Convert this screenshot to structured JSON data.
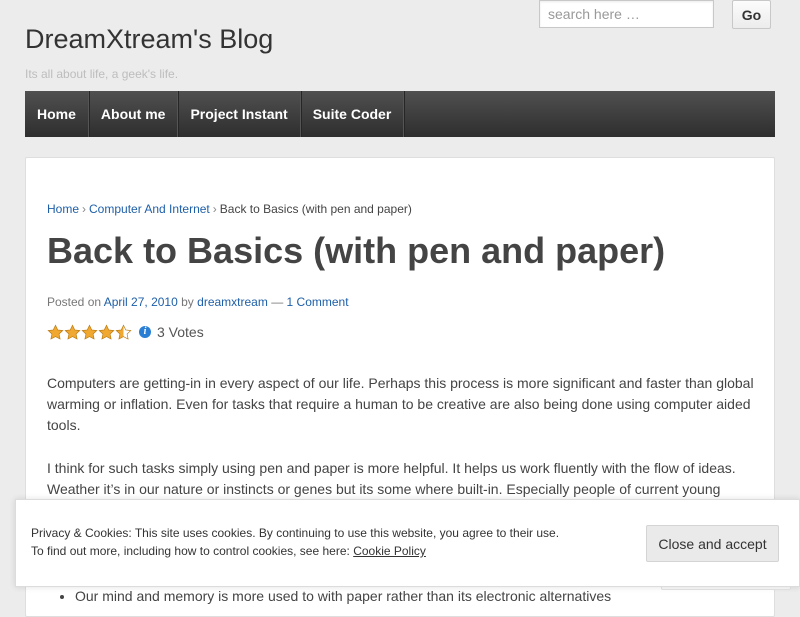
{
  "site": {
    "title": "DreamXtream's Blog",
    "tagline": "Its all about life, a geek's life."
  },
  "search": {
    "placeholder": "search here …",
    "button_label": "Go"
  },
  "nav": {
    "items": [
      {
        "label": "Home"
      },
      {
        "label": "About me"
      },
      {
        "label": "Project Instant"
      },
      {
        "label": "Suite Coder"
      }
    ]
  },
  "breadcrumb": {
    "home": "Home",
    "category": "Computer And Internet",
    "current": "Back to Basics (with pen and paper)",
    "separator": "›"
  },
  "post": {
    "title": "Back to Basics (with pen and paper)",
    "meta": {
      "posted_on_prefix": "Posted on",
      "date": "April 27, 2010",
      "by": "by",
      "author": "dreamxtream",
      "dash": "—",
      "comments": "1 Comment"
    },
    "rating": {
      "stars": 4.5,
      "max_stars": 5,
      "votes_text": "3 Votes",
      "star_color": "#f0a830"
    },
    "paragraphs": [
      "Computers are getting-in in every aspect of our life. Perhaps this process is more significant and faster than global warming or inflation. Even for tasks that require a human to be creative are also being done using computer aided tools.",
      "I think for such tasks simply using pen and paper is more helpful. It helps us work fluently with the flow of ideas. Weather it’s in our nature or instincts or genes but its some where built-in. Especially people of current young"
    ],
    "bullets": [
      "Our mind and memory is more used to with paper rather than its electronic alternatives"
    ]
  },
  "cookie_banner": {
    "line1": "Privacy & Cookies: This site uses cookies. By continuing to use this website, you agree to their use.",
    "line2_prefix": "To find out more, including how to control cookies, see here:",
    "policy_link": "Cookie Policy",
    "accept_label": "Close and accept"
  },
  "colors": {
    "link": "#1e5fa8",
    "nav_bg": "#3a3a3a",
    "page_bg": "#ececec"
  }
}
